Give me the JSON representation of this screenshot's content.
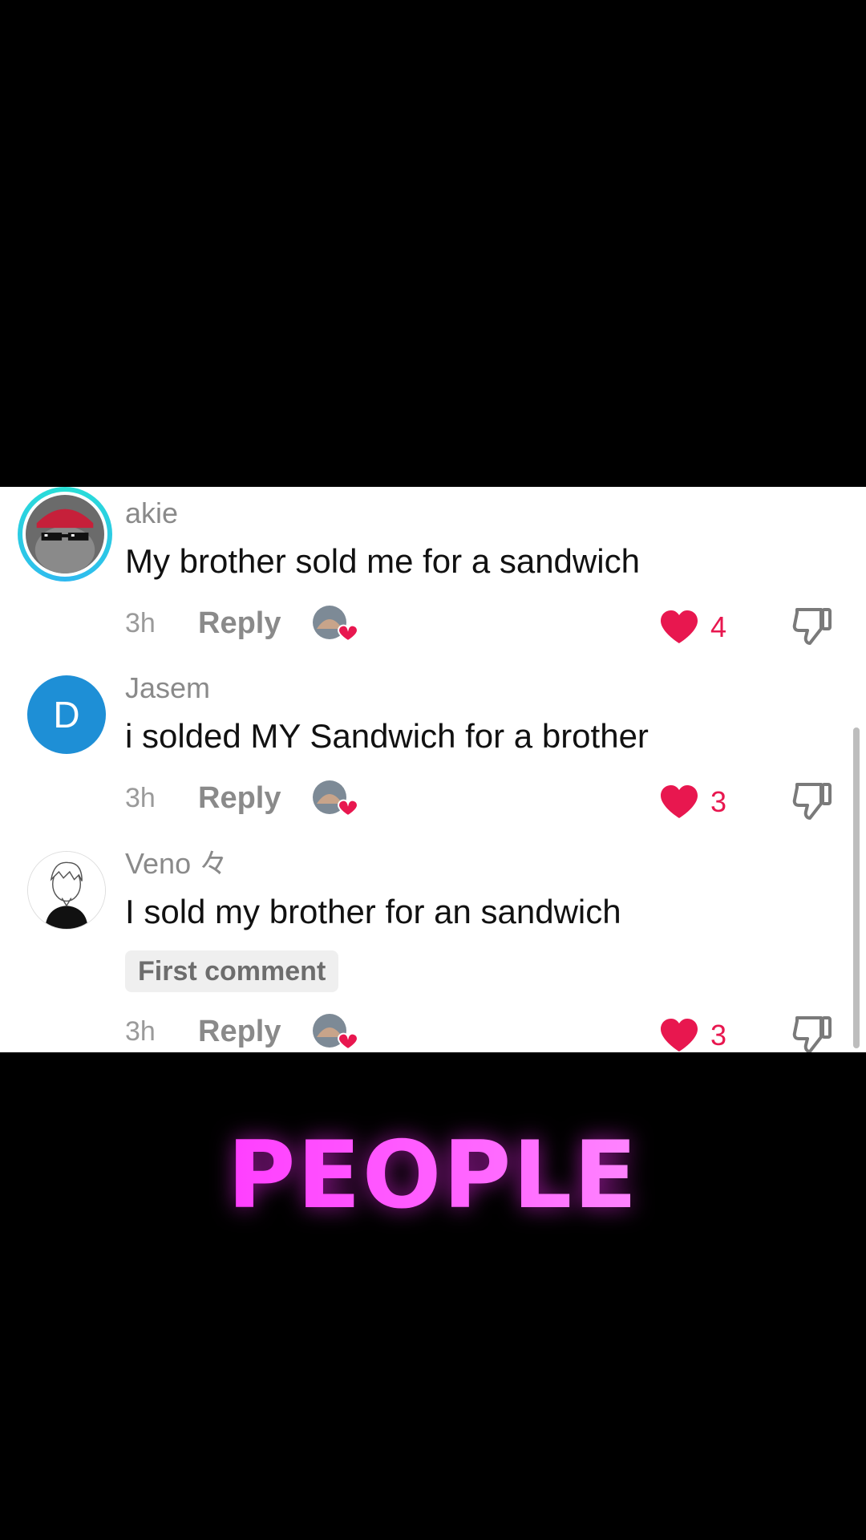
{
  "comments": [
    {
      "username": "akie",
      "text": "My brother sold me for a sandwich",
      "time": "3h",
      "reply_label": "Reply",
      "likes": "4",
      "badge": ""
    },
    {
      "username": "Jasem",
      "avatar_letter": "D",
      "text": "i solded MY Sandwich for a brother",
      "time": "3h",
      "reply_label": "Reply",
      "likes": "3",
      "badge": ""
    },
    {
      "username": "Veno 々",
      "text": "I sold my brother for an sandwich",
      "time": "3h",
      "reply_label": "Reply",
      "likes": "3",
      "badge": "First comment"
    }
  ],
  "overlay": {
    "title": "PEOPLE"
  },
  "colors": {
    "like": "#e8174f",
    "avatar_blue": "#1e8fd6",
    "title_magenta": "#ff1aff"
  },
  "icons": [
    "heart-icon",
    "dislike-icon",
    "creator-liked-icon"
  ]
}
